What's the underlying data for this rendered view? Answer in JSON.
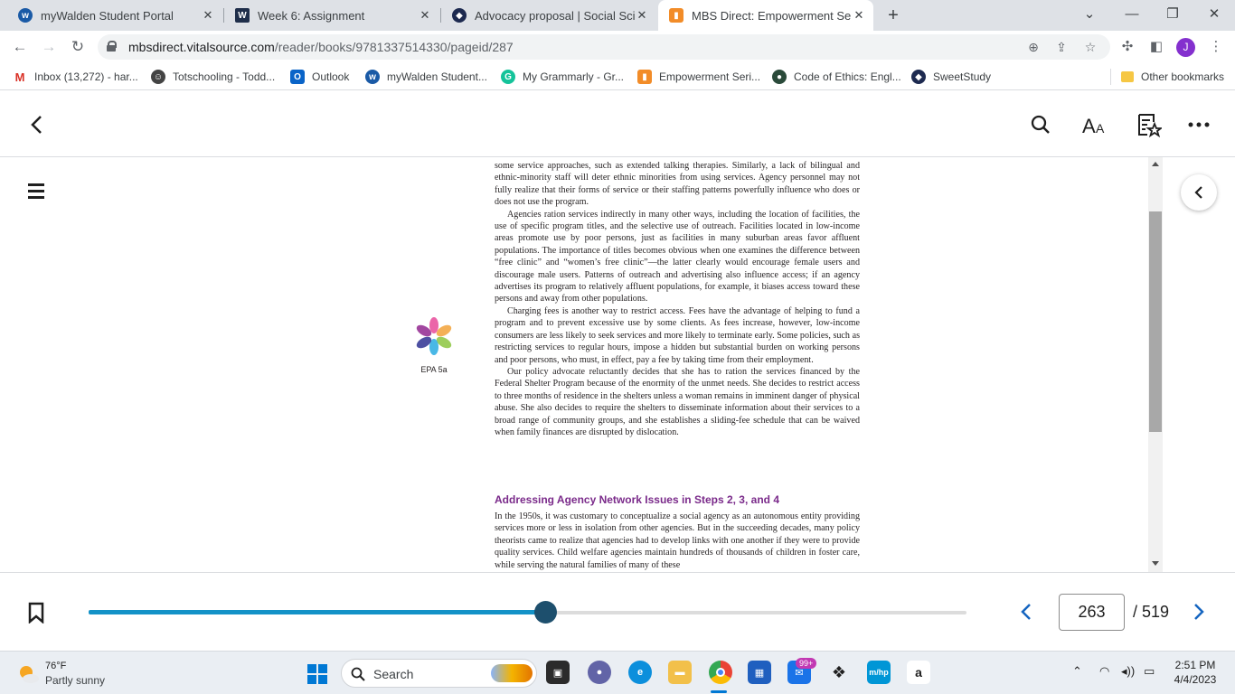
{
  "browser": {
    "tabs": [
      {
        "title": "myWalden Student Portal",
        "icon": "walden-icon"
      },
      {
        "title": "Week 6: Assignment",
        "icon": "walden-w-icon"
      },
      {
        "title": "Advocacy proposal | Social Scien",
        "icon": "sweetstudy-icon"
      },
      {
        "title": "MBS Direct: Empowerment Series",
        "icon": "mbs-icon",
        "active": true
      }
    ],
    "url_host": "mbsdirect.vitalsource.com",
    "url_path": "/reader/books/9781337514330/pageid/287",
    "profile_initial": "J",
    "bookmarks": [
      {
        "label": "Inbox (13,272) - har...",
        "icon": "gmail-icon"
      },
      {
        "label": "Totschooling - Todd...",
        "icon": "totschooling-icon"
      },
      {
        "label": "Outlook",
        "icon": "outlook-icon"
      },
      {
        "label": "myWalden Student...",
        "icon": "walden-icon"
      },
      {
        "label": "My Grammarly - Gr...",
        "icon": "grammarly-icon"
      },
      {
        "label": "Empowerment Seri...",
        "icon": "mbs-icon"
      },
      {
        "label": "Code of Ethics: Engl...",
        "icon": "nasw-icon"
      },
      {
        "label": "SweetStudy",
        "icon": "sweetstudy-icon"
      }
    ],
    "other_bookmarks": "Other bookmarks"
  },
  "reader": {
    "paragraphs": [
      {
        "text": "some service approaches, such as extended talking therapies. Similarly, a lack of bilingual and ethnic-minority staff will deter ethnic minorities from using services. Agency personnel may not fully realize that their forms of service or their staffing patterns powerfully influence who does or does not use the program.",
        "indent": false
      },
      {
        "text": "Agencies ration services indirectly in many other ways, including the location of facilities, the use of specific program titles, and the selective use of outreach. Facilities located in low-income areas promote use by poor persons, just as facilities in many suburban areas favor affluent populations. The importance of titles becomes obvious when one examines the difference between “free clinic” and “women’s free clinic”—the latter clearly would encourage female users and discourage male users. Patterns of outreach and advertising also influence access; if an agency advertises its program to relatively affluent populations, for example, it biases access toward these persons and away from other populations.",
        "indent": true
      },
      {
        "text": "Charging fees is another way to restrict access. Fees have the advantage of helping to fund a program and to prevent excessive use by some clients. As fees increase, however, low-income consumers are less likely to seek services and more likely to terminate early. Some policies, such as restricting services to regular hours, impose a hidden but substantial burden on working persons and poor persons, who must, in effect, pay a fee by taking time from their employment.",
        "indent": true
      },
      {
        "text": "Our policy advocate reluctantly decides that she has to ration the services financed by the Federal Shelter Program because of the enormity of the unmet needs. She decides to restrict access to three months of residence in the shelters unless a woman remains in imminent danger of physical abuse. She also decides to require the shelters to disseminate information about their services to a broad range of community groups, and she establishes a sliding-fee schedule that can be waived when family finances are disrupted by dislocation.",
        "indent": true
      }
    ],
    "epa_label": "EPA 5a",
    "heading": "Addressing Agency Network Issues in Steps 2, 3, and 4",
    "after_heading": "In the 1950s, it was customary to conceptualize a social agency as an autonomous entity providing services more or less in isolation from other agencies. But in the succeeding decades, many policy theorists came to realize that agencies had to develop links with one another if they were to provide quality services. Child welfare agencies maintain hundreds of thousands of children in foster care, while serving the natural families of many of these",
    "current_page": "263",
    "total_pages": "/ 519",
    "progress_fraction": 0.52,
    "accent_color": "#1392c7",
    "heading_color": "#7a2a8a"
  },
  "taskbar": {
    "temp": "76°F",
    "condition": "Partly sunny",
    "search_label": "Search",
    "mail_badge": "99+",
    "time": "2:51 PM",
    "date": "4/4/2023"
  }
}
